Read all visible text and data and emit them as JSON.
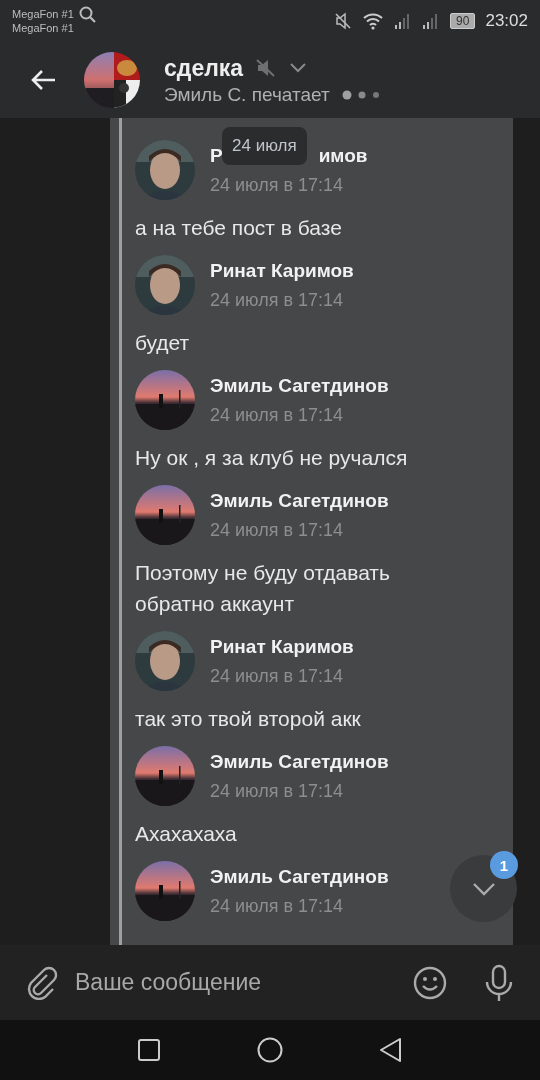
{
  "status_bar": {
    "carriers": [
      "MegaFon #1",
      "MegaFon #1"
    ],
    "battery": "90",
    "time": "23:02"
  },
  "header": {
    "title": "сделка",
    "muted": true,
    "subtitle": "Эмиль С. печатает"
  },
  "date_tooltip": "24 июля",
  "messages": [
    {
      "author": "Р",
      "author_tail": "имов",
      "time": "24 июля в 17:14",
      "text": "а на тебе пост в базе"
    },
    {
      "author": "Ринат Каримов",
      "time": "24 июля в 17:14",
      "text": "будет"
    },
    {
      "author": "Эмиль Сагетдинов",
      "time": "24 июля в 17:14",
      "text": "Ну ок , я за клуб не ручался"
    },
    {
      "author": "Эмиль Сагетдинов",
      "time": "24 июля в 17:14",
      "text": "Поэтому не буду отдавать обратно аккаунт"
    },
    {
      "author": "Ринат Каримов",
      "time": "24 июля в 17:14",
      "text": "так это твой второй акк"
    },
    {
      "author": "Эмиль Сагетдинов",
      "time": "24 июля в 17:14",
      "text": "Ахахахаха"
    },
    {
      "author": "Эмиль Сагетдинов",
      "time": "24 июля в 17:14"
    }
  ],
  "scroll_button": {
    "badge": "1"
  },
  "composer": {
    "placeholder": "Ваше сообщение"
  }
}
